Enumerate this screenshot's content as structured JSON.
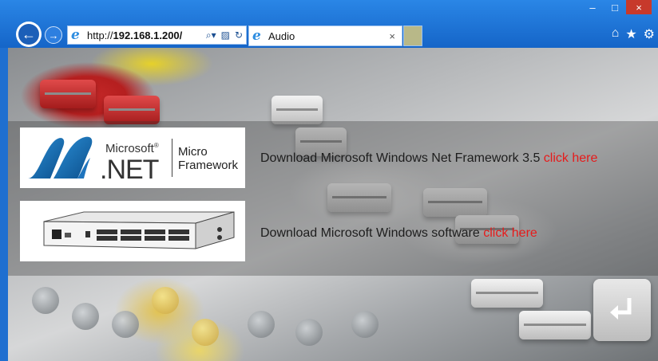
{
  "browser": {
    "url_prefix": "http://",
    "url_host": "192.168.1.200/",
    "tab_title": "Audio",
    "tab_close": "×",
    "window_minimize": "‒",
    "window_maximize": "□",
    "window_close": "×",
    "icons": [
      "back-icon",
      "forward-icon",
      "ie-icon",
      "search-icon",
      "compat-icon",
      "refresh-icon",
      "home-icon",
      "favorites-star-icon",
      "settings-gear-icon"
    ]
  },
  "logos": {
    "ms_word": "Microsoft",
    "net_word": ".NET",
    "micro_line1": "Micro",
    "micro_line2": "Framework"
  },
  "downloads": [
    {
      "text": "Download Microsoft Windows Net Framework 3.5",
      "link": "click here"
    },
    {
      "text": "Download Microsoft Windows software",
      "link": "click here"
    }
  ],
  "colors": {
    "chrome": "#1565c8",
    "link": "#e61b1b",
    "text": "#1d1d1d"
  },
  "return_button": {
    "icon": "return-arrow-icon"
  }
}
